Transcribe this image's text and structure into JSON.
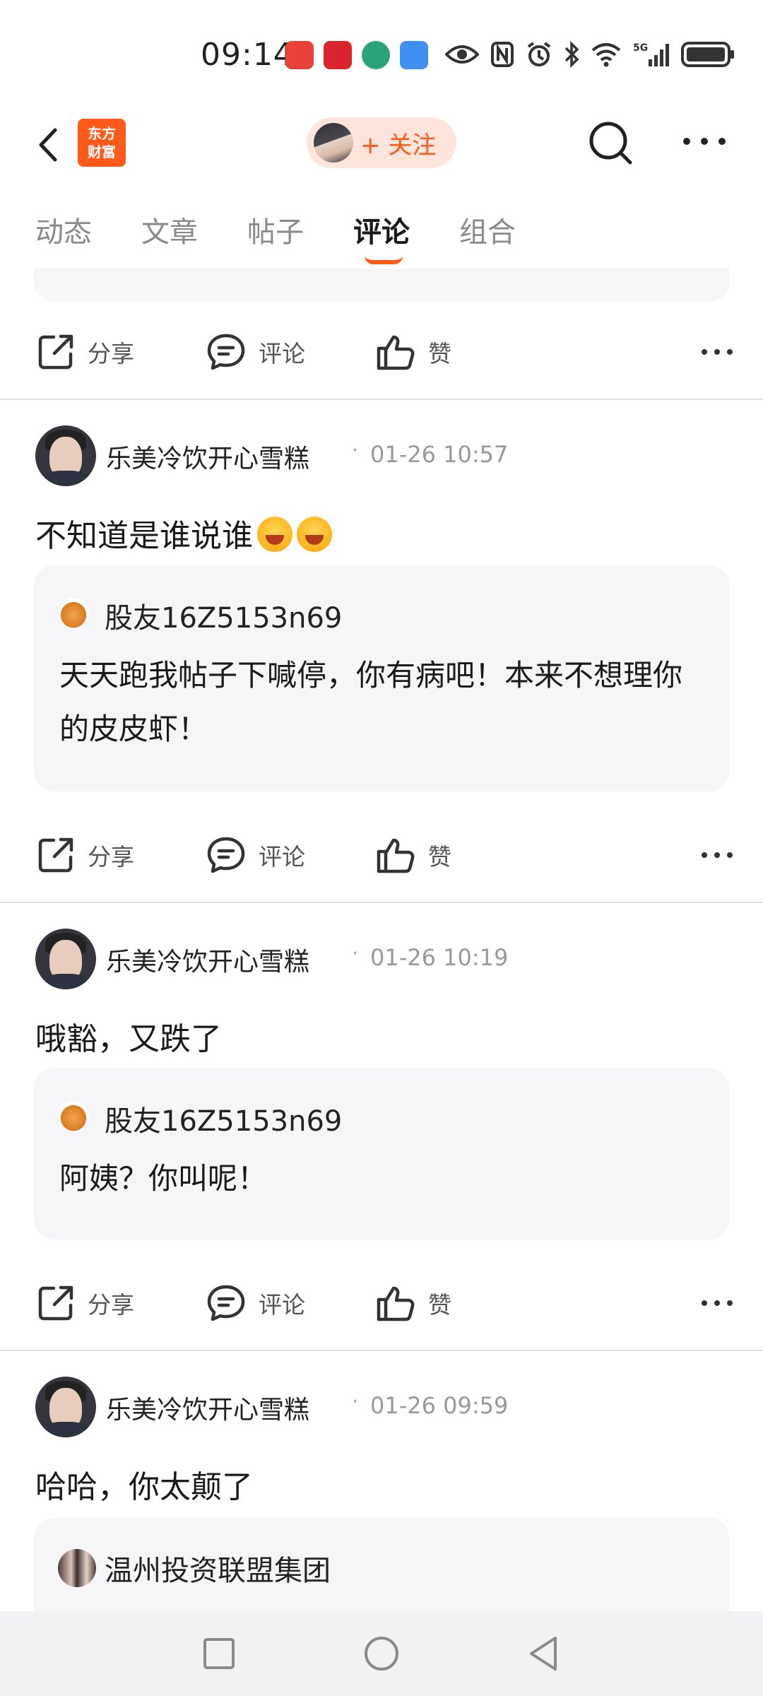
{
  "status_bar": {
    "time": "09:14",
    "network": "5G"
  },
  "header": {
    "logo_line1": "东方",
    "logo_line2": "财富",
    "follow_label": "+ 关注"
  },
  "tabs": [
    {
      "label": "动态"
    },
    {
      "label": "文章"
    },
    {
      "label": "帖子"
    },
    {
      "label": "评论",
      "active": true
    },
    {
      "label": "组合"
    }
  ],
  "actions": {
    "share": "分享",
    "comment": "评论",
    "like": "赞"
  },
  "posts": [
    {
      "author": "乐美冷饮开心雪糕",
      "time": "01-26 10:57",
      "text": "不知道是谁说谁",
      "emoji": [
        "laughing-emoji",
        "laughing-emoji"
      ],
      "quote": {
        "author": "股友16Z5153n69",
        "text": "天天跑我帖子下喊停，你有病吧！本来不想理你的皮皮虾！"
      }
    },
    {
      "author": "乐美冷饮开心雪糕",
      "time": "01-26 10:19",
      "text": "哦豁，又跌了",
      "quote": {
        "author": "股友16Z5153n69",
        "text": "阿姨？你叫呢！"
      }
    },
    {
      "author": "乐美冷饮开心雪糕",
      "time": "01-26 09:59",
      "text": "哈哈，你太颠了",
      "quote": {
        "author": "温州投资联盟集团"
      }
    }
  ],
  "colors": {
    "accent": "#ff5a1a",
    "follow_bg": "#fde5db",
    "quote_bg": "#f6f6f8",
    "text_muted": "#999999"
  }
}
